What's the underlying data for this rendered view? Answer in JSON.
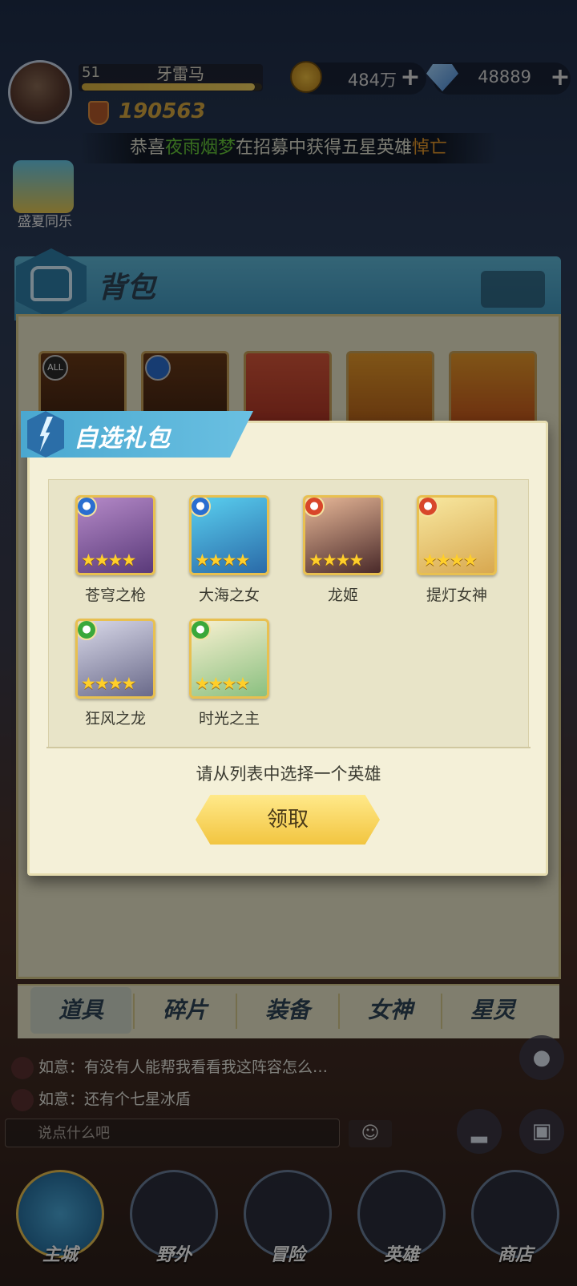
{
  "header": {
    "level": "51",
    "player_name": "牙雷马",
    "exp_fraction": 0.96,
    "power": "190563",
    "gold": "484万",
    "gems": "48889",
    "plus": "+"
  },
  "announcement": {
    "prefix": "恭喜",
    "player": "夜雨烟梦",
    "middle": "在招募中获得五星英雄",
    "hero": "悼亡"
  },
  "event": {
    "label": "盛夏同乐"
  },
  "backpack": {
    "title": "背包",
    "badge_all": "ALL",
    "tabs": [
      "道具",
      "碎片",
      "装备",
      "女神",
      "星灵"
    ],
    "active_tab": "道具"
  },
  "modal": {
    "title": "自选礼包",
    "prompt": "请从列表中选择一个英雄",
    "claim_label": "领取",
    "heroes": [
      {
        "name": "苍穹之枪",
        "element": "water",
        "stars": 4
      },
      {
        "name": "大海之女",
        "element": "water",
        "stars": 4
      },
      {
        "name": "龙姬",
        "element": "fire",
        "stars": 4
      },
      {
        "name": "提灯女神",
        "element": "fire",
        "stars": 4
      },
      {
        "name": "狂风之龙",
        "element": "wind",
        "stars": 4
      },
      {
        "name": "时光之主",
        "element": "wind",
        "stars": 4
      }
    ],
    "star_glyphs": "★★★★"
  },
  "chat": {
    "lines": [
      "如意：有没有人能帮我看看我这阵容怎么…",
      "如意：还有个七星冰盾"
    ],
    "input_placeholder": "说点什么吧",
    "emoji": "☺"
  },
  "nav": [
    "主城",
    "野外",
    "冒险",
    "英雄",
    "商店"
  ],
  "colors": {
    "accent_blue": "#4aa8d0",
    "button_yellow": "#f2c540",
    "star_gold": "#ffcf2a"
  }
}
